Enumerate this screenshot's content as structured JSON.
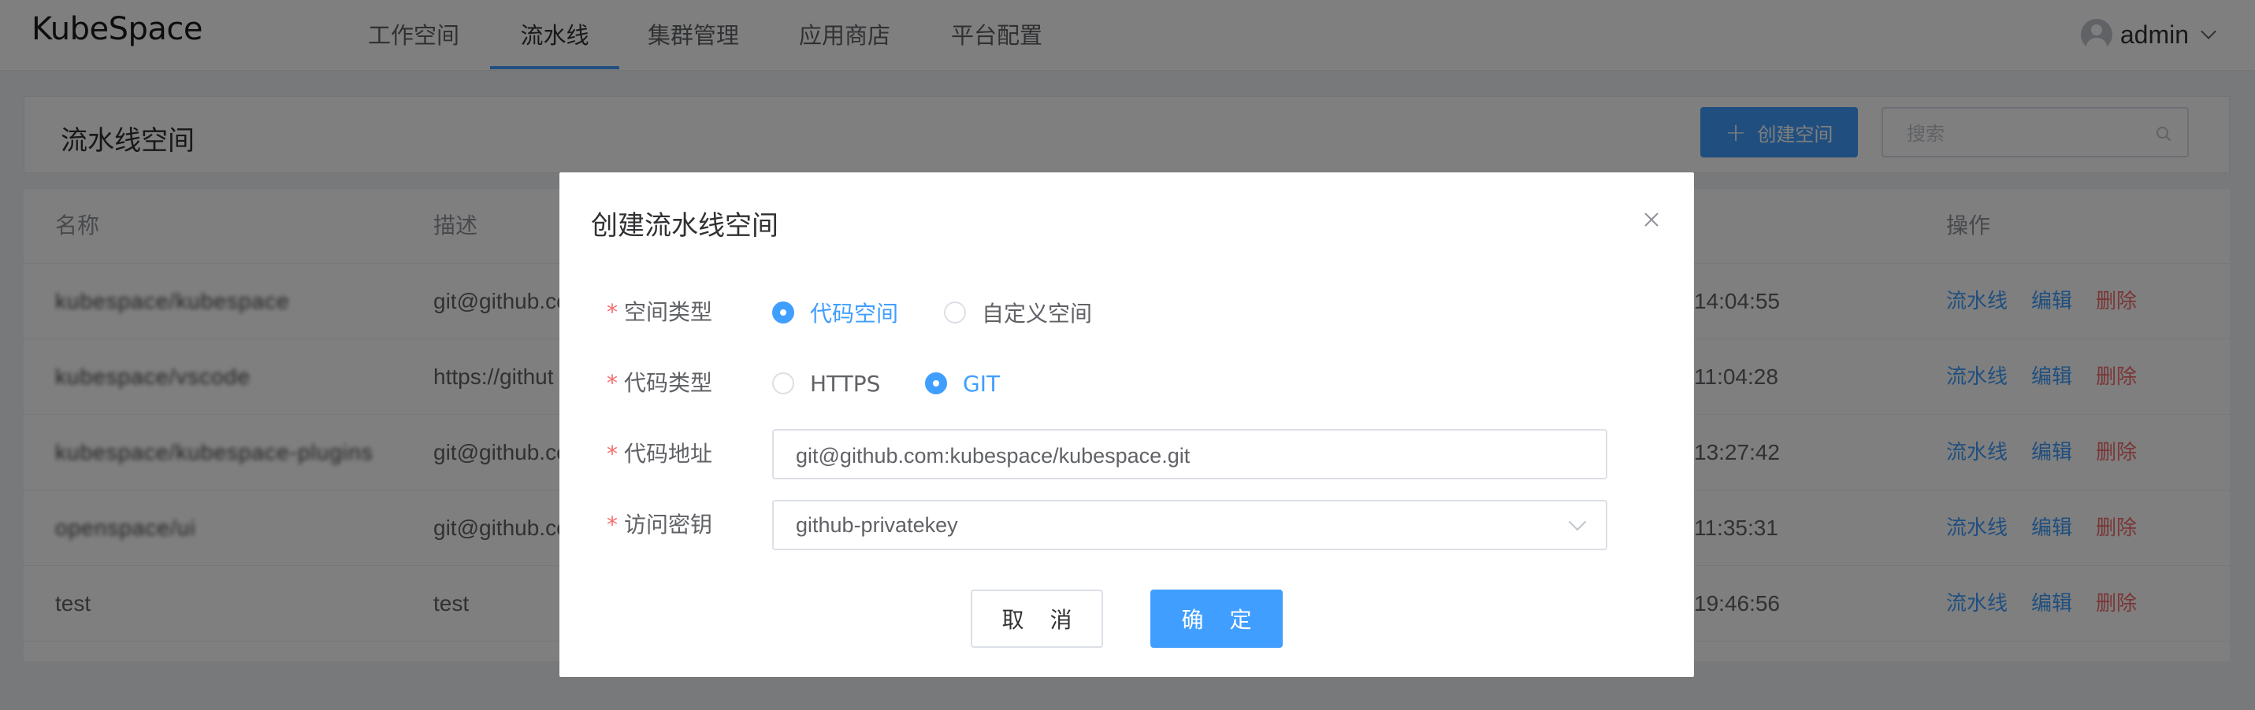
{
  "header": {
    "logo": "KubeSpace",
    "nav": [
      {
        "label": "工作空间",
        "active": false
      },
      {
        "label": "流水线",
        "active": true
      },
      {
        "label": "集群管理",
        "active": false
      },
      {
        "label": "应用商店",
        "active": false
      },
      {
        "label": "平台配置",
        "active": false
      }
    ],
    "user": "admin"
  },
  "page": {
    "title": "流水线空间",
    "create_label": "创建空间",
    "search_placeholder": "搜索"
  },
  "table": {
    "columns": [
      "名称",
      "描述",
      "操作"
    ],
    "rows": [
      {
        "name": "kubespace/kubespace",
        "desc": "git@github.co",
        "time": "14:04:55",
        "name_blurred": true
      },
      {
        "name": "kubespace/vscode",
        "desc": "https://githut",
        "time": "11:04:28",
        "name_blurred": true
      },
      {
        "name": "kubespace/kubespace-plugins",
        "desc": "git@github.co",
        "time": "13:27:42",
        "name_blurred": true
      },
      {
        "name": "openspace/ui",
        "desc": "git@github.co",
        "time": "11:35:31",
        "name_blurred": true
      },
      {
        "name": "test",
        "desc": "test",
        "time": "19:46:56",
        "name_blurred": false
      }
    ],
    "actions": {
      "pipeline": "流水线",
      "edit": "编辑",
      "delete": "删除"
    }
  },
  "dialog": {
    "title": "创建流水线空间",
    "space_type": {
      "label": "空间类型",
      "options": [
        {
          "label": "代码空间",
          "checked": true
        },
        {
          "label": "自定义空间",
          "checked": false
        }
      ]
    },
    "code_type": {
      "label": "代码类型",
      "options": [
        {
          "label": "HTTPS",
          "checked": false
        },
        {
          "label": "GIT",
          "checked": true
        }
      ]
    },
    "code_url": {
      "label": "代码地址",
      "value": "git@github.com:kubespace/kubespace.git"
    },
    "access_key": {
      "label": "访问密钥",
      "value": "github-privatekey"
    },
    "cancel": "取 消",
    "confirm": "确 定"
  },
  "colors": {
    "primary": "#409eff",
    "danger": "#f56c6c",
    "mask": "rgba(0,0,0,0.5)"
  }
}
